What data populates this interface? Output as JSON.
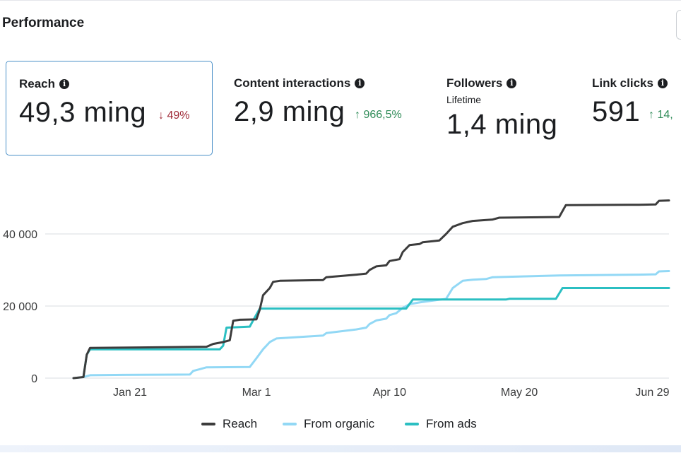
{
  "header": {
    "title": "Performance"
  },
  "metrics": [
    {
      "label": "Reach",
      "value": "49,3 ming",
      "change": "49%",
      "direction": "down",
      "selected": true,
      "icon": "info-icon"
    },
    {
      "label": "Content interactions",
      "value": "2,9 ming",
      "change": "966,5%",
      "direction": "up",
      "icon": "info-icon"
    },
    {
      "label": "Followers",
      "sublabel": "Lifetime",
      "value": "1,4 ming",
      "icon": "info-icon"
    },
    {
      "label": "Link clicks",
      "value": "591",
      "change": "14,",
      "direction": "up",
      "icon": "info-icon"
    }
  ],
  "chart_data": {
    "type": "line",
    "x_ticks": [
      "Jan 21",
      "Mar 1",
      "Apr 10",
      "May 20",
      "Jun 29"
    ],
    "y_ticks": [
      "0",
      "20 000",
      "40 000"
    ],
    "ylim": [
      0,
      50000
    ],
    "grid": true,
    "legend_position": "bottom",
    "x_domain": [
      0,
      179
    ],
    "series": [
      {
        "name": "Reach",
        "color": "#3c3c3c",
        "points": [
          [
            0,
            0
          ],
          [
            3,
            300
          ],
          [
            4,
            6500
          ],
          [
            5,
            8400
          ],
          [
            20,
            8500
          ],
          [
            40,
            8700
          ],
          [
            42,
            9500
          ],
          [
            45,
            10000
          ],
          [
            47,
            10500
          ],
          [
            48,
            15900
          ],
          [
            50,
            16200
          ],
          [
            55,
            16300
          ],
          [
            56,
            19000
          ],
          [
            57,
            23000
          ],
          [
            59,
            25000
          ],
          [
            60,
            26700
          ],
          [
            62,
            27000
          ],
          [
            75,
            27200
          ],
          [
            76,
            28000
          ],
          [
            85,
            28700
          ],
          [
            88,
            29000
          ],
          [
            89,
            30000
          ],
          [
            91,
            31000
          ],
          [
            94,
            31300
          ],
          [
            95,
            32500
          ],
          [
            98,
            33000
          ],
          [
            99,
            35000
          ],
          [
            101,
            36900
          ],
          [
            104,
            37200
          ],
          [
            105,
            37700
          ],
          [
            110,
            38200
          ],
          [
            112,
            40000
          ],
          [
            114,
            42000
          ],
          [
            117,
            43000
          ],
          [
            120,
            43600
          ],
          [
            126,
            44000
          ],
          [
            128,
            44500
          ],
          [
            146,
            44700
          ],
          [
            148,
            48000
          ],
          [
            170,
            48100
          ],
          [
            175,
            48200
          ],
          [
            176,
            49200
          ],
          [
            179,
            49300
          ]
        ]
      },
      {
        "name": "From organic",
        "color": "#92d8f5",
        "points": [
          [
            0,
            0
          ],
          [
            3,
            300
          ],
          [
            5,
            800
          ],
          [
            15,
            900
          ],
          [
            35,
            1000
          ],
          [
            36,
            2000
          ],
          [
            38,
            2500
          ],
          [
            40,
            3000
          ],
          [
            53,
            3100
          ],
          [
            55,
            5500
          ],
          [
            57,
            8000
          ],
          [
            59,
            10000
          ],
          [
            61,
            11000
          ],
          [
            75,
            11800
          ],
          [
            76,
            12500
          ],
          [
            85,
            13500
          ],
          [
            88,
            14000
          ],
          [
            89,
            15000
          ],
          [
            91,
            16000
          ],
          [
            94,
            16500
          ],
          [
            95,
            17500
          ],
          [
            97,
            18000
          ],
          [
            99,
            19500
          ],
          [
            101,
            20500
          ],
          [
            104,
            21000
          ],
          [
            112,
            22000
          ],
          [
            114,
            25000
          ],
          [
            117,
            27000
          ],
          [
            120,
            27300
          ],
          [
            124,
            27500
          ],
          [
            126,
            28000
          ],
          [
            146,
            28500
          ],
          [
            170,
            28700
          ],
          [
            175,
            28800
          ],
          [
            176,
            29600
          ],
          [
            179,
            29700
          ]
        ]
      },
      {
        "name": "From ads",
        "color": "#2bbfc2",
        "points": [
          [
            3,
            300
          ],
          [
            4,
            6500
          ],
          [
            5,
            8000
          ],
          [
            44,
            8000
          ],
          [
            45,
            9000
          ],
          [
            46,
            14000
          ],
          [
            53,
            14300
          ],
          [
            54,
            16000
          ],
          [
            56,
            19300
          ],
          [
            100,
            19300
          ],
          [
            102,
            21800
          ],
          [
            130,
            21800
          ],
          [
            131,
            22000
          ],
          [
            145,
            22000
          ],
          [
            147,
            25000
          ],
          [
            179,
            25000
          ]
        ]
      }
    ]
  }
}
